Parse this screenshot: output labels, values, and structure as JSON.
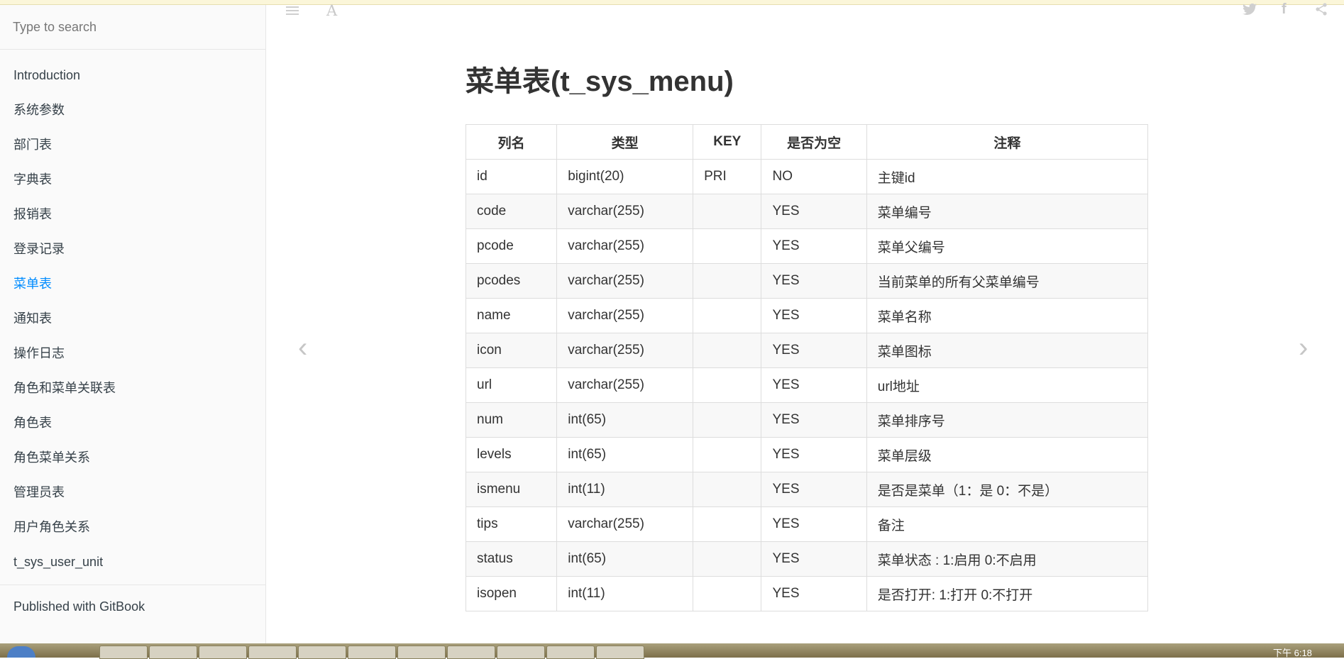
{
  "search": {
    "placeholder": "Type to search"
  },
  "sidebar": {
    "items": [
      {
        "label": "Introduction",
        "active": false
      },
      {
        "label": "系统参数",
        "active": false
      },
      {
        "label": "部门表",
        "active": false
      },
      {
        "label": "字典表",
        "active": false
      },
      {
        "label": "报销表",
        "active": false
      },
      {
        "label": "登录记录",
        "active": false
      },
      {
        "label": "菜单表",
        "active": true
      },
      {
        "label": "通知表",
        "active": false
      },
      {
        "label": "操作日志",
        "active": false
      },
      {
        "label": "角色和菜单关联表",
        "active": false
      },
      {
        "label": "角色表",
        "active": false
      },
      {
        "label": "角色菜单关系",
        "active": false
      },
      {
        "label": "管理员表",
        "active": false
      },
      {
        "label": "用户角色关系",
        "active": false
      },
      {
        "label": "t_sys_user_unit",
        "active": false
      }
    ],
    "footer": "Published with GitBook"
  },
  "page": {
    "title": "菜单表(t_sys_menu)",
    "table": {
      "headers": [
        "列名",
        "类型",
        "KEY",
        "是否为空",
        "注释"
      ],
      "rows": [
        [
          "id",
          "bigint(20)",
          "PRI",
          "NO",
          "主键id"
        ],
        [
          "code",
          "varchar(255)",
          "",
          "YES",
          "菜单编号"
        ],
        [
          "pcode",
          "varchar(255)",
          "",
          "YES",
          "菜单父编号"
        ],
        [
          "pcodes",
          "varchar(255)",
          "",
          "YES",
          "当前菜单的所有父菜单编号"
        ],
        [
          "name",
          "varchar(255)",
          "",
          "YES",
          "菜单名称"
        ],
        [
          "icon",
          "varchar(255)",
          "",
          "YES",
          "菜单图标"
        ],
        [
          "url",
          "varchar(255)",
          "",
          "YES",
          "url地址"
        ],
        [
          "num",
          "int(65)",
          "",
          "YES",
          "菜单排序号"
        ],
        [
          "levels",
          "int(65)",
          "",
          "YES",
          "菜单层级"
        ],
        [
          "ismenu",
          "int(11)",
          "",
          "YES",
          "是否是菜单（1：是 0：不是）"
        ],
        [
          "tips",
          "varchar(255)",
          "",
          "YES",
          "备注"
        ],
        [
          "status",
          "int(65)",
          "",
          "YES",
          "菜单状态 : 1:启用 0:不启用"
        ],
        [
          "isopen",
          "int(11)",
          "",
          "YES",
          "是否打开: 1:打开 0:不打开"
        ]
      ]
    }
  },
  "toolbar": {
    "font_icon_glyph": "A",
    "facebook_glyph": "f",
    "twitter_glyph": "🐦",
    "share_glyph": "⋖"
  },
  "navigation": {
    "prev_glyph": "‹",
    "next_glyph": "›"
  },
  "taskbar": {
    "clock": "下午 6:18"
  },
  "colors": {
    "active_link": "#008cff",
    "sidebar_bg": "#fafafa",
    "text": "#333333"
  }
}
